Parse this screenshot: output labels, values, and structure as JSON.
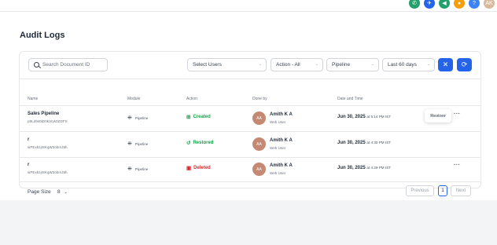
{
  "topbar": {
    "icons": [
      {
        "name": "phone-icon",
        "glyph": "✆",
        "color": "#22a06b"
      },
      {
        "name": "rocket-icon",
        "glyph": "✈",
        "color": "#2563eb"
      },
      {
        "name": "megaphone-icon",
        "glyph": "◀",
        "color": "#22a06b"
      },
      {
        "name": "bell-icon",
        "glyph": "●",
        "color": "#f59e0b"
      },
      {
        "name": "help-icon",
        "glyph": "?",
        "color": "#3b82f6"
      }
    ],
    "avatar": "AK",
    "avatar_color": "#d9b99b"
  },
  "page": {
    "title": "Audit Logs"
  },
  "filters": {
    "search_placeholder": "Search Document ID",
    "users": "Select Users",
    "action": "Action - All",
    "module": "Pipeline",
    "range": "Last 60 days"
  },
  "table": {
    "headers": {
      "name": "Name",
      "module": "Module",
      "action": "Action",
      "done_by": "Done by",
      "date": "Date and Time"
    },
    "rows": [
      {
        "name": "Sales Pipeline",
        "id": "p9Ld940iD0kVryk0ZDFS",
        "module": "Pipeline",
        "action": "Created",
        "action_glyph": "⊞",
        "action_color": "#16a34a",
        "avatar": "AA",
        "user": "Amith K A",
        "role": "Web User",
        "date": "Jun 30, 2025",
        "time": "at 5:14 PM IST"
      },
      {
        "name": "r",
        "id": "siPExbzjr8KqW3obmJ5h",
        "module": "Pipeline",
        "action": "Restored",
        "action_glyph": "↺",
        "action_color": "#16a34a",
        "avatar": "AA",
        "user": "Amith K A",
        "role": "Web User",
        "date": "Jun 30, 2025",
        "time": "at 4:30 PM IST"
      },
      {
        "name": "r",
        "id": "siPExbzjr8KqW3obmJ5h",
        "module": "Pipeline",
        "action": "Deleted",
        "action_glyph": "🗑",
        "action_color": "#dc2626",
        "avatar": "AA",
        "user": "Amith K A",
        "role": "Web User",
        "date": "Jun 30, 2025",
        "time": "at 4:29 PM IST"
      }
    ]
  },
  "popup": {
    "label": "Restore"
  },
  "footer": {
    "page_size_label": "Page Size",
    "page_size": "8",
    "previous": "Previous",
    "page": "1",
    "next": "Next"
  }
}
